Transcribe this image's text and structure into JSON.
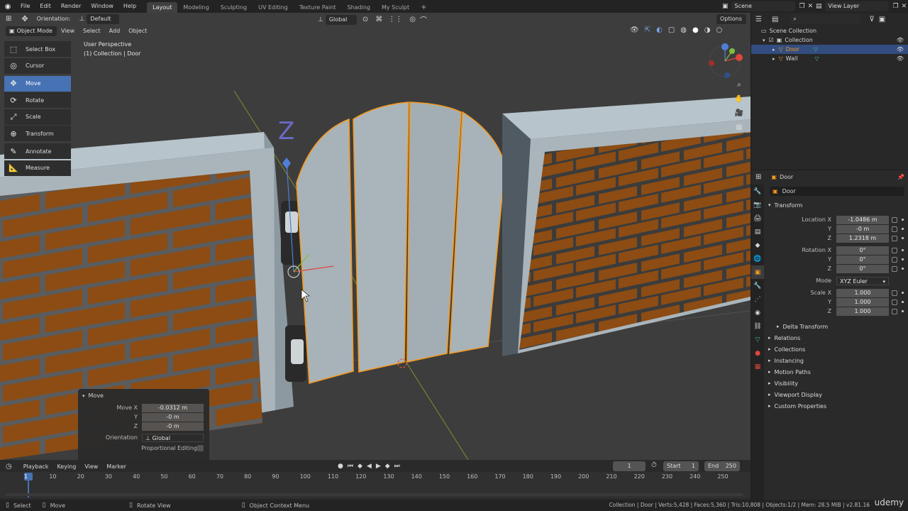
{
  "topbar": {
    "menus": [
      "File",
      "Edit",
      "Render",
      "Window",
      "Help"
    ],
    "workspaces": [
      "Layout",
      "Modeling",
      "Sculpting",
      "UV Editing",
      "Texture Paint",
      "Shading",
      "My Sculpt"
    ],
    "active_workspace": "Layout",
    "scene": "Scene",
    "view_layer": "View Layer"
  },
  "viewport": {
    "orientation_label": "Orientation:",
    "orientation_value": "Default",
    "transform_orientation": "Global",
    "options": "Options",
    "mode": "Object Mode",
    "menus": [
      "View",
      "Select",
      "Add",
      "Object"
    ],
    "perspective": "User Perspective",
    "collection_info": "(1) Collection | Door"
  },
  "toolbar": {
    "tools": [
      {
        "label": "Select Box",
        "icon": "select-box-icon",
        "active": false
      },
      {
        "label": "Cursor",
        "icon": "cursor-icon",
        "active": false
      },
      {
        "label": "Move",
        "icon": "move-icon",
        "active": true
      },
      {
        "label": "Rotate",
        "icon": "rotate-icon",
        "active": false
      },
      {
        "label": "Scale",
        "icon": "scale-icon",
        "active": false
      },
      {
        "label": "Transform",
        "icon": "transform-icon",
        "active": false
      },
      {
        "label": "Annotate",
        "icon": "annotate-icon",
        "active": false
      },
      {
        "label": "Measure",
        "icon": "measure-icon",
        "active": false
      }
    ]
  },
  "operator_panel": {
    "title": "Move",
    "move_x_label": "Move X",
    "move_x": "-0.0312 m",
    "y_label": "Y",
    "y": "-0 m",
    "z_label": "Z",
    "z": "-0 m",
    "orientation_label": "Orientation",
    "orientation": "Global",
    "proportional_label": "Proportional Editing"
  },
  "timeline": {
    "menus": [
      "Playback",
      "Keying",
      "View",
      "Marker"
    ],
    "current_frame": "1",
    "start_label": "Start",
    "start": "1",
    "end_label": "End",
    "end": "250",
    "ticks": [
      "1",
      "10",
      "20",
      "30",
      "40",
      "50",
      "60",
      "70",
      "80",
      "90",
      "100",
      "110",
      "120",
      "130",
      "140",
      "150",
      "160",
      "170",
      "180",
      "190",
      "200",
      "210",
      "220",
      "230",
      "240",
      "250"
    ]
  },
  "outliner": {
    "items": [
      {
        "label": "Scene Collection",
        "indent": 0,
        "selected": false
      },
      {
        "label": "Collection",
        "indent": 1,
        "selected": false
      },
      {
        "label": "Door",
        "indent": 2,
        "selected": true
      },
      {
        "label": "Wall",
        "indent": 2,
        "selected": false
      }
    ]
  },
  "properties": {
    "object_name_header": "Door",
    "object_name": "Door",
    "transform_label": "Transform",
    "location_x_label": "Location X",
    "location_x": "-1.0486 m",
    "location_y": "-0 m",
    "location_z": "1.2318 m",
    "rotation_x_label": "Rotation X",
    "rotation_x": "0°",
    "rotation_y": "0°",
    "rotation_z": "0°",
    "mode_label": "Mode",
    "mode": "XYZ Euler",
    "scale_x_label": "Scale X",
    "scale_x": "1.000",
    "scale_y": "1.000",
    "scale_z": "1.000",
    "y_label": "Y",
    "z_label": "Z",
    "delta_transform": "Delta Transform",
    "sections": [
      "Relations",
      "Collections",
      "Instancing",
      "Motion Paths",
      "Visibility",
      "Viewport Display",
      "Custom Properties"
    ]
  },
  "statusbar": {
    "select": "Select",
    "move": "Move",
    "rotate_view": "Rotate View",
    "context_menu": "Object Context Menu",
    "stats": "Collection | Door | Verts:5,428 | Faces:5,360 | Tris:10,808 | Objects:1/2 | Mem: 28.5 MiB | v2.81.16",
    "watermark": "udemy"
  },
  "colors": {
    "accent": "#4772b3",
    "selected_outline": "#f39a1e",
    "brick": "#8a4a12",
    "wall": "#8a9aa4",
    "door": "#a7b2b8"
  }
}
